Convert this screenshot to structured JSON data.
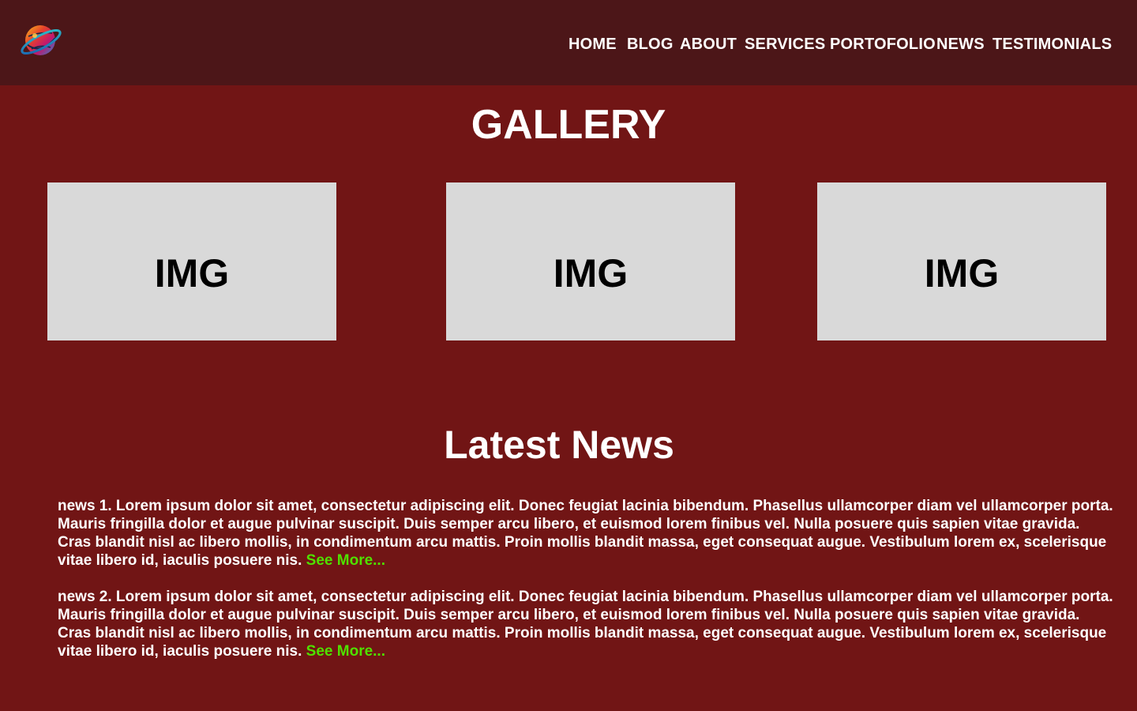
{
  "header": {
    "logo_icon": "planet-logo-icon",
    "nav": {
      "home": "HOME",
      "blog": "BLOG",
      "about": "ABOUT",
      "services": "SERVICES",
      "portfolio": "PORTOFOLIO",
      "news": "NEWS",
      "testimonials": "TESTIMONIALS"
    }
  },
  "gallery": {
    "title": "GALLERY",
    "images": [
      {
        "label": "IMG"
      },
      {
        "label": "IMG"
      },
      {
        "label": "IMG"
      }
    ]
  },
  "news": {
    "title": "Latest News",
    "items": [
      {
        "text": "news 1. Lorem ipsum dolor sit amet, consectetur adipiscing elit. Donec feugiat lacinia bibendum. Phasellus ullamcorper diam vel ullamcorper porta. Mauris fringilla dolor et augue pulvinar suscipit. Duis semper arcu libero, et euismod lorem finibus vel. Nulla posuere quis sapien vitae gravida. Cras blandit nisl ac libero mollis, in condimentum arcu mattis. Proin mollis blandit massa, eget consequat augue. Vestibulum lorem ex, scelerisque vitae libero id, iaculis posuere nis.",
        "link": "See More..."
      },
      {
        "text": "news 2. Lorem ipsum dolor sit amet, consectetur adipiscing elit. Donec feugiat lacinia bibendum. Phasellus ullamcorper diam vel ullamcorper porta. Mauris fringilla dolor et augue pulvinar suscipit. Duis semper arcu libero, et euismod lorem finibus vel. Nulla posuere quis sapien vitae gravida. Cras blandit nisl ac libero mollis, in condimentum arcu mattis. Proin mollis blandit massa, eget consequat augue. Vestibulum lorem ex, scelerisque vitae libero id, iaculis posuere nis.",
        "link": "See More..."
      }
    ]
  },
  "colors": {
    "page_background": "#711515",
    "header_background": "#4c1618",
    "image_placeholder": "#d9d9d9",
    "link_green": "#4fe000"
  }
}
